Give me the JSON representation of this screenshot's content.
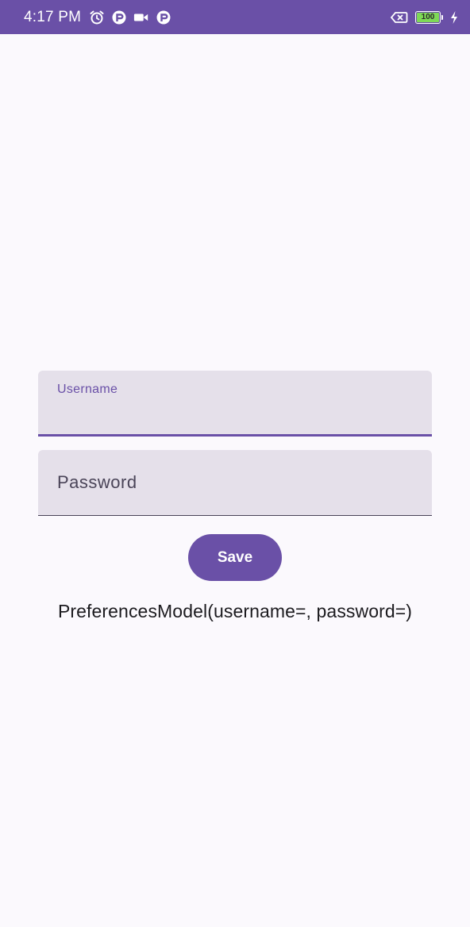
{
  "status_bar": {
    "time": "4:17 PM",
    "left_icons": [
      "alarm-icon",
      "app-notification-icon",
      "video-camera-icon",
      "app-notification-icon"
    ],
    "battery_level": "100",
    "battery_fraction": 1.0,
    "background_color": "#6a50a7"
  },
  "form": {
    "username": {
      "label": "Username",
      "value": "",
      "focused": true
    },
    "password": {
      "label": "Password",
      "value": "",
      "focused": false
    },
    "save_label": "Save"
  },
  "result": {
    "text": "PreferencesModel(username=, password=)"
  },
  "colors": {
    "primary": "#6a50a7",
    "field_background": "#e5e0ea",
    "page_background": "#fbf9fd",
    "text": "#1c1b1f"
  }
}
